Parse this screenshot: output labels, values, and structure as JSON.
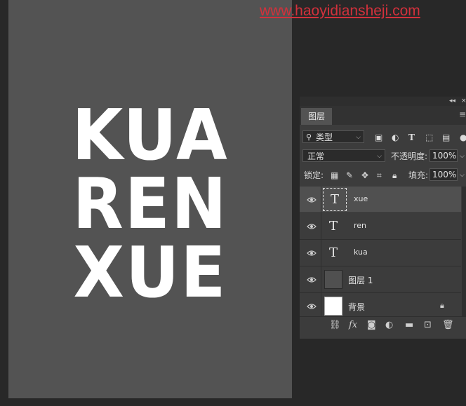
{
  "watermark": "www.haoyidiansheji.com",
  "canvas_text": [
    "KUA",
    "REN",
    "XUE"
  ],
  "panel": {
    "tab": "图层",
    "filter": {
      "label": "类型",
      "icons": [
        "image-icon",
        "adjust-icon",
        "text-icon",
        "shape-icon",
        "smart-icon"
      ]
    },
    "blend_mode": "正常",
    "opacity_label": "不透明度:",
    "opacity_value": "100%",
    "lock_label": "锁定:",
    "fill_label": "填充:",
    "fill_value": "100%",
    "layers": [
      {
        "name": "xue",
        "type": "text",
        "selected": true
      },
      {
        "name": "ren",
        "type": "text",
        "selected": false
      },
      {
        "name": "kua",
        "type": "text",
        "selected": false
      },
      {
        "name": "图层 1",
        "type": "pixel",
        "selected": false
      },
      {
        "name": "背景",
        "type": "background",
        "selected": false
      }
    ],
    "thumb_glyph": "T",
    "bottom_fx": "fx"
  }
}
